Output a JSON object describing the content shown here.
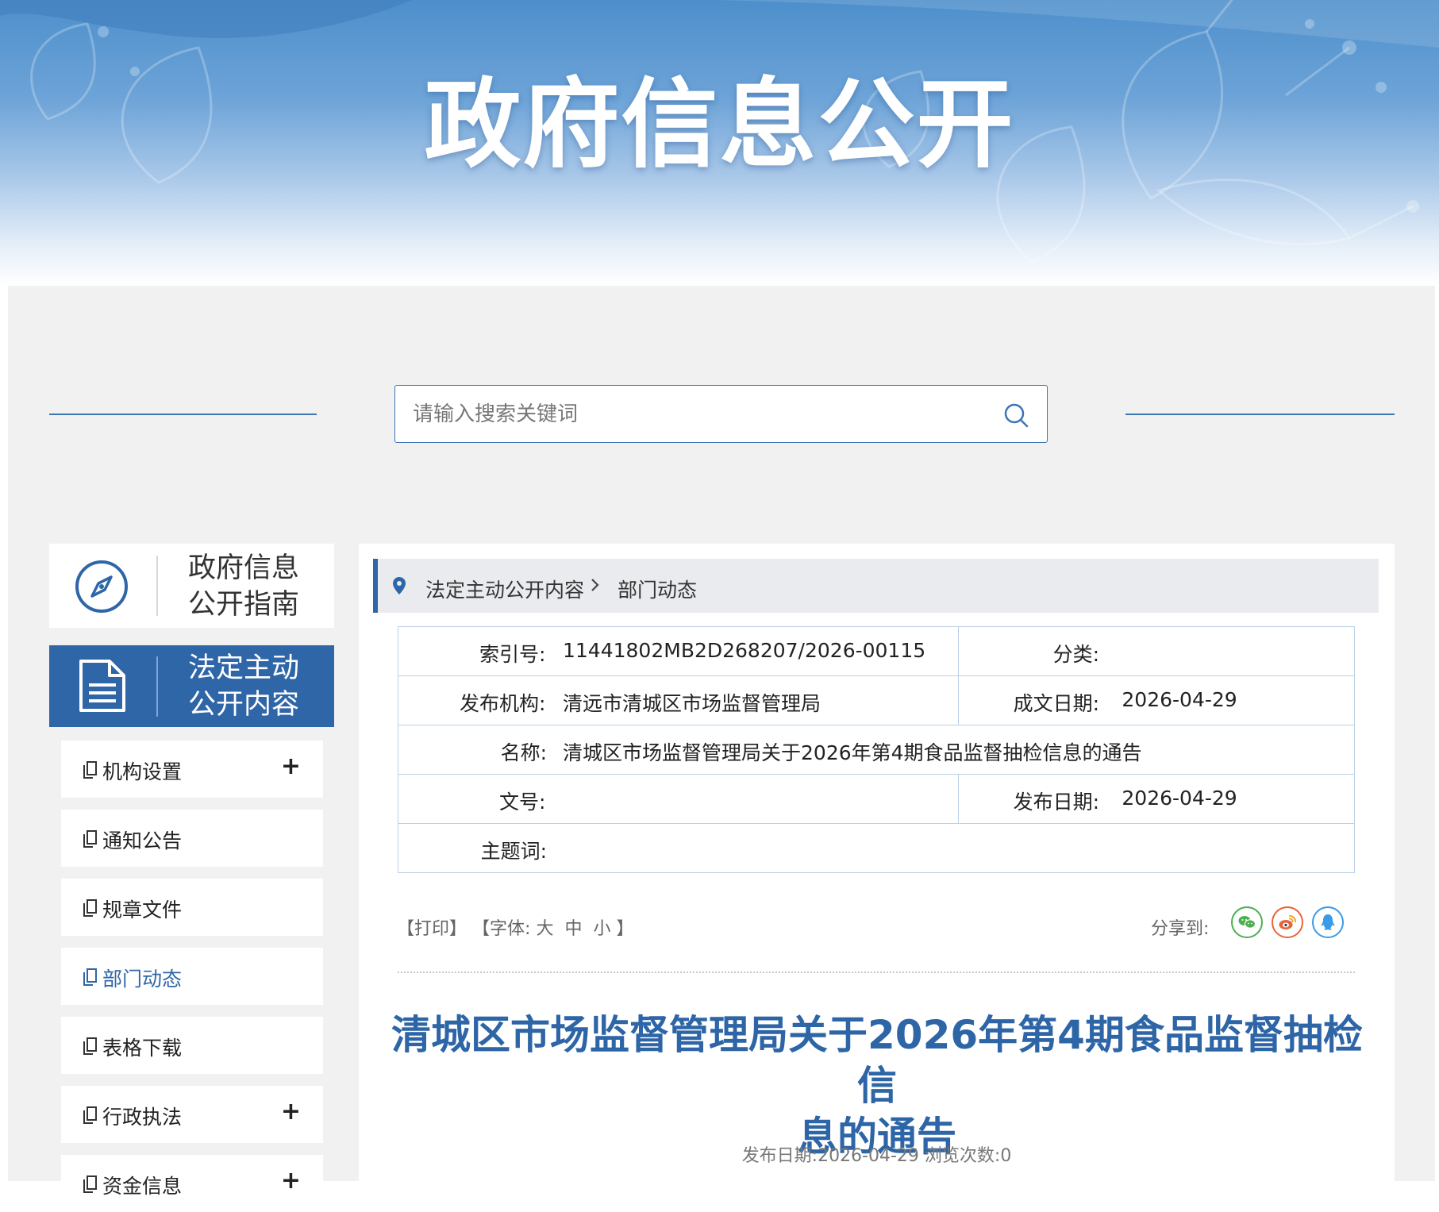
{
  "banner": {
    "title": "政府信息公开"
  },
  "search": {
    "placeholder": "请输入搜索关键词"
  },
  "sidebar": {
    "guide_line1": "政府信息",
    "guide_line2": "公开指南",
    "content_line1": "法定主动",
    "content_line2": "公开内容",
    "items": [
      {
        "label": "机构设置",
        "expandable": "+"
      },
      {
        "label": "通知公告"
      },
      {
        "label": "规章文件"
      },
      {
        "label": "部门动态"
      },
      {
        "label": "表格下载"
      },
      {
        "label": "行政执法",
        "expandable": "+"
      },
      {
        "label": "资金信息",
        "expandable": "+"
      }
    ]
  },
  "breadcrumb": {
    "level1": "法定主动公开内容",
    "level2": "部门动态"
  },
  "meta": {
    "index_label": "索引号:",
    "index_value": "11441802MB2D268207/2026-00115",
    "category_label": "分类:",
    "category_value": "",
    "publisher_label": "发布机构:",
    "publisher_value": "清远市清城区市场监督管理局",
    "created_label": "成文日期:",
    "created_value": "2026-04-29",
    "name_label": "名称:",
    "name_value": "清城区市场监督管理局关于2026年第4期食品监督抽检信息的通告",
    "docno_label": "文号:",
    "docno_value": "",
    "published_label": "发布日期:",
    "published_value": "2026-04-29",
    "subject_label": "主题词:",
    "subject_value": ""
  },
  "tools": {
    "print": "【打印】",
    "font_prefix": "【字体:",
    "font_large": "大",
    "font_medium": "中",
    "font_small": "小",
    "font_suffix": "】",
    "share_label": "分享到:"
  },
  "article": {
    "title_line1": "清城区市场监督管理局关于2026年第4期食品监督抽检信",
    "title_line2": "息的通告",
    "meta_line": "发布日期:2026-04-29 浏览次数:0"
  },
  "colors": {
    "brand_blue": "#2f66a8",
    "wechat": "#4caf50",
    "weibo": "#e8653a",
    "qq": "#3a9be8"
  }
}
